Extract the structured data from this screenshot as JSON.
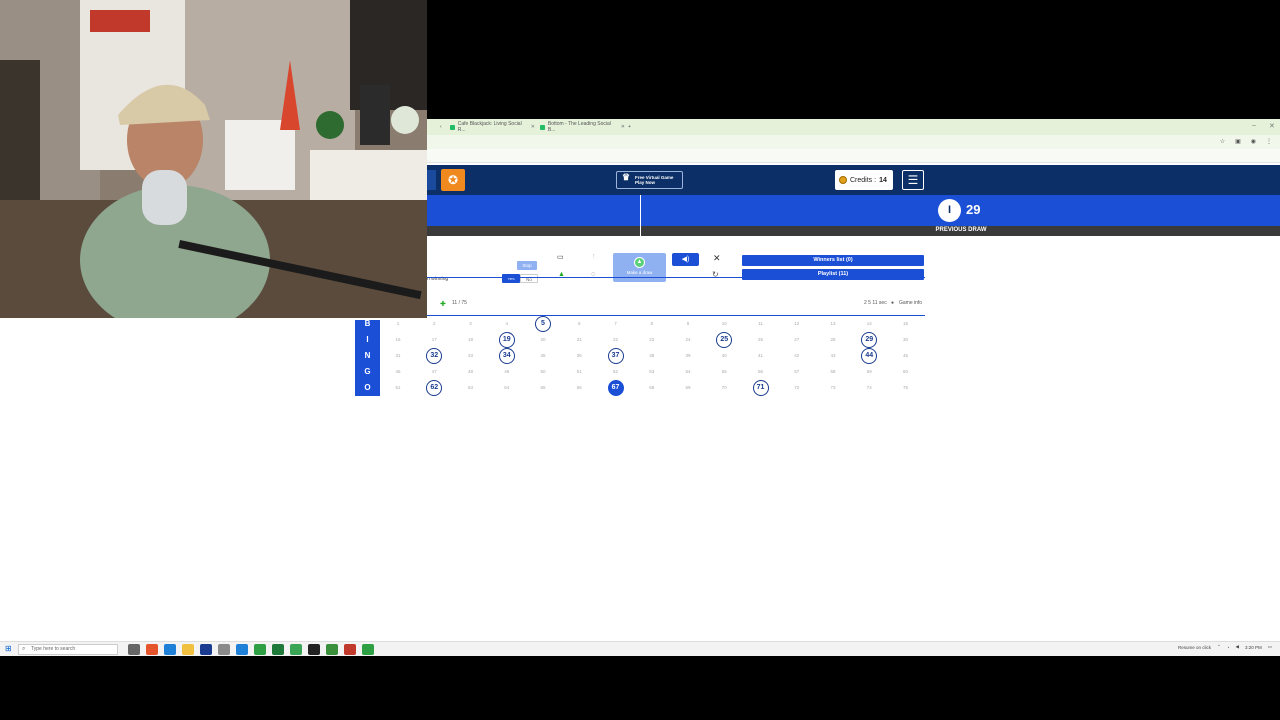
{
  "browser": {
    "tabs": [
      {
        "title": "Cafe Blackjack: Living Social R..."
      },
      {
        "title": "Bottom - The Leading Social B..."
      }
    ],
    "tab_add": "+"
  },
  "header": {
    "virtual_game_line1": "Free Virtual Game",
    "virtual_game_line2": "Play Now",
    "credits_label": "Credits : ",
    "credits_value": "14",
    "menu_glyph": "☰"
  },
  "previous_draw": {
    "letter": "I",
    "number": "29",
    "label": "PREVIOUS DRAW"
  },
  "controls": {
    "auto_winning_label": "n winning",
    "stop_label": "Stop",
    "yes_label": "Yes",
    "no_label": "No",
    "make_draw_label": "Make a draw",
    "winners_list_label": "Winners list (0)",
    "playlist_label": "Playlist (11)"
  },
  "meta": {
    "ball_count": "11 / 75",
    "speed": "2 5 11 sec",
    "game_info": "Game info"
  },
  "board": {
    "letters": [
      "B",
      "I",
      "N",
      "G",
      "O"
    ],
    "rows": [
      {
        "letter": "B",
        "start": 1,
        "called": [
          5
        ],
        "latest": null
      },
      {
        "letter": "I",
        "start": 16,
        "called": [
          19,
          25,
          29
        ],
        "latest": null
      },
      {
        "letter": "N",
        "start": 31,
        "called": [
          32,
          34,
          37,
          44
        ],
        "latest": null
      },
      {
        "letter": "G",
        "start": 46,
        "called": [],
        "latest": null
      },
      {
        "letter": "O",
        "start": 61,
        "called": [
          62,
          67,
          71
        ],
        "latest": 67
      }
    ]
  },
  "taskbar": {
    "search_placeholder": "Type here to search",
    "tray_text": "Resume on click",
    "clock": "3:20 PM"
  }
}
